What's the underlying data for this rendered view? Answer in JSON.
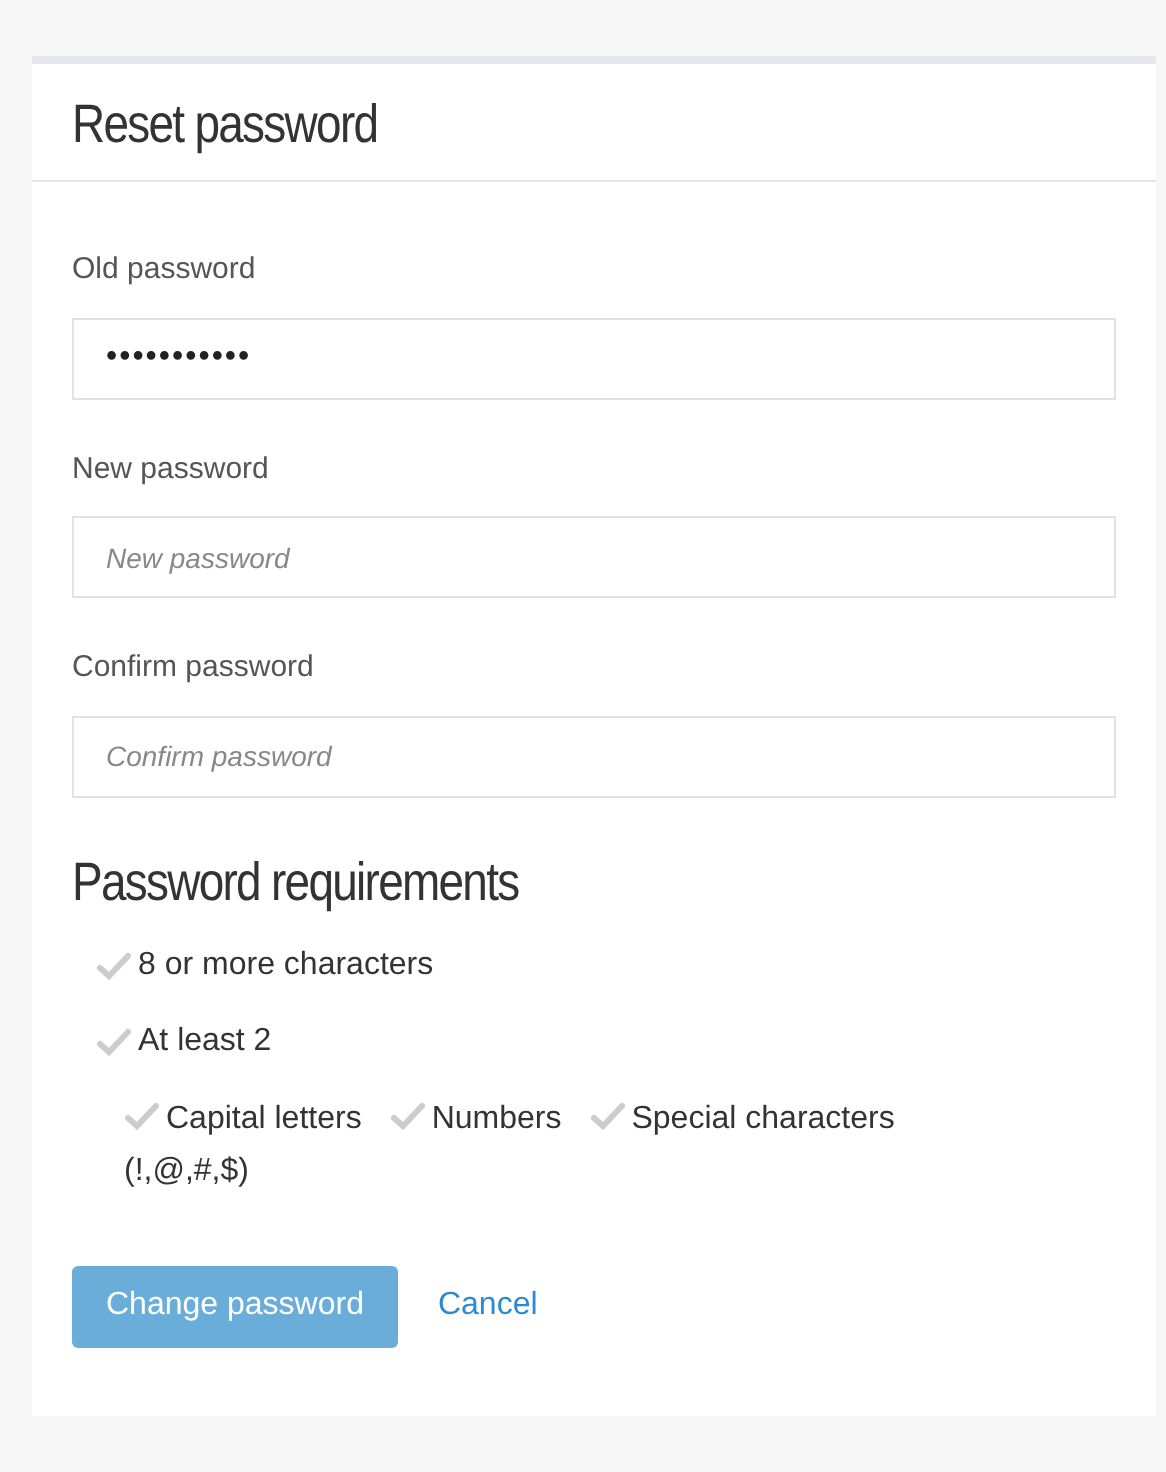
{
  "title": "Reset password",
  "fields": [
    {
      "label": "Old password",
      "value": "•••••••••••"
    },
    {
      "label": "New password",
      "placeholder": "New password"
    },
    {
      "label": "Confirm password",
      "placeholder": "Confirm password"
    }
  ],
  "requirements_title": "Password requirements",
  "requirements": [
    {
      "label": "8 or more characters",
      "met": false
    },
    {
      "label": "At least 2",
      "met": false,
      "children": [
        {
          "label": "Capital letters",
          "met": false
        },
        {
          "label": "Numbers",
          "met": false
        },
        {
          "label": "Special characters",
          "note": "(!,@,#,$)",
          "met": false
        }
      ]
    }
  ],
  "submit": {
    "label": "Change password",
    "disabled": true
  },
  "cancel": "Cancel"
}
